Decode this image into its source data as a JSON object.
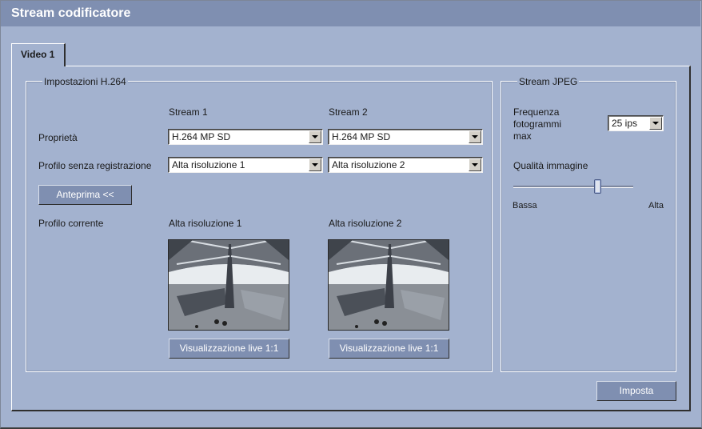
{
  "window": {
    "title": "Stream codificatore"
  },
  "tabs": [
    {
      "label": "Video 1",
      "active": true
    }
  ],
  "h264": {
    "legend": "Impostazioni H.264",
    "stream1_header": "Stream 1",
    "stream2_header": "Stream 2",
    "properties_label": "Proprietà",
    "stream1_property": "H.264 MP SD",
    "stream2_property": "H.264 MP SD",
    "profile_label": "Profilo senza registrazione",
    "stream1_profile": "Alta risoluzione 1",
    "stream2_profile": "Alta risoluzione 2",
    "preview_button": "Anteprima <<",
    "current_profile_label": "Profilo corrente",
    "stream1_current": "Alta risoluzione 1",
    "stream2_current": "Alta risoluzione 2",
    "live_button_1": "Visualizzazione live 1:1",
    "live_button_2": "Visualizzazione live 1:1"
  },
  "jpeg": {
    "legend": "Stream JPEG",
    "frame_rate_label": "Frequenza fotogrammi max",
    "frame_rate_value": "25 ips",
    "quality_label": "Qualità immagine",
    "quality_low": "Bassa",
    "quality_high": "Alta",
    "quality_level": 0.7
  },
  "set_button": "Imposta",
  "colors": {
    "background": "#a3b2cf",
    "titlebar": "#7f8fb1",
    "button": "#7f8fb1"
  },
  "icons": {
    "dropdown": "chevron-down-icon"
  }
}
